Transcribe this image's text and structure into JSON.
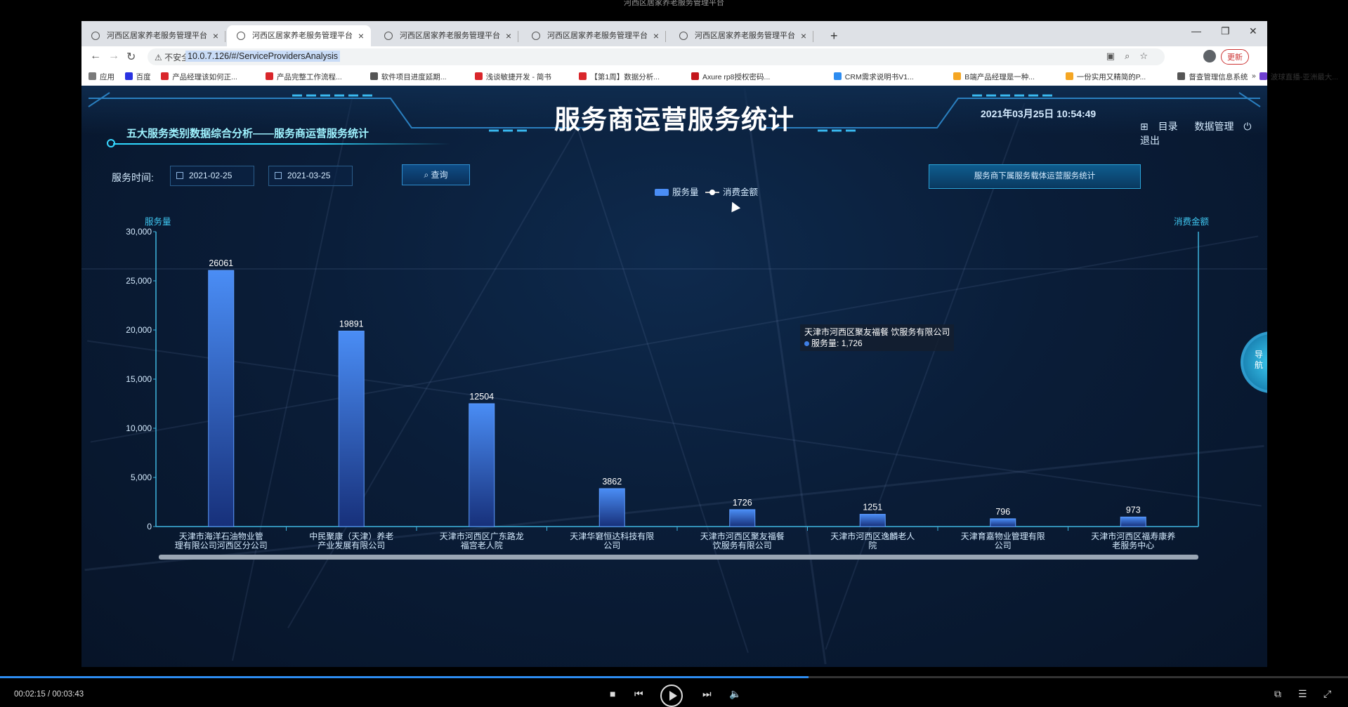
{
  "player": {
    "window_title": "河西区居家养老服务管理平台",
    "time_code": "00:02:15 / 00:03:43",
    "progress": 0.6
  },
  "browser": {
    "tabs": [
      {
        "label": "河西区居家养老服务管理平台",
        "active": false
      },
      {
        "label": "河西区居家养老服务管理平台",
        "active": true
      },
      {
        "label": "河西区居家养老服务管理平台",
        "active": false
      },
      {
        "label": "河西区居家养老服务管理平台",
        "active": false
      },
      {
        "label": "河西区居家养老服务管理平台",
        "active": false
      }
    ],
    "insecure_label": "不安全",
    "url": "10.0.7.126/#/ServiceProvidersAnalysis",
    "update_label": "更新",
    "bookmarks": [
      {
        "label": "应用",
        "color": "#7a7a7a"
      },
      {
        "label": "百度",
        "color": "#2932e1"
      },
      {
        "label": "产品经理该如何正...",
        "color": "#d9262b"
      },
      {
        "label": "产品完整工作流程...",
        "color": "#d9262b"
      },
      {
        "label": "软件项目进度延期...",
        "color": "#555555"
      },
      {
        "label": "浅谈敏捷开发 - 简书",
        "color": "#d9262b"
      },
      {
        "label": "【第1周】数据分析...",
        "color": "#d9262b"
      },
      {
        "label": "Axure rp8授权密码...",
        "color": "#c4161c"
      },
      {
        "label": "CRM需求说明书V1...",
        "color": "#2d8cf0"
      },
      {
        "label": "B端产品经理是一种...",
        "color": "#f5a623"
      },
      {
        "label": "一份实用又精简的P...",
        "color": "#f5a623"
      },
      {
        "label": "督查管理信息系统",
        "color": "#555555"
      },
      {
        "label": "波球直播-亚洲最大...",
        "color": "#6f3fd1"
      }
    ]
  },
  "dashboard": {
    "title": "服务商运营服务统计",
    "datetime": "2021年03月25日 10:54:49",
    "menu": {
      "catalog": "目录",
      "data_mgmt": "数据管理",
      "logout": "退出"
    },
    "subtitle": "五大服务类别数据综合分析——服务商运营服务统计",
    "time_label": "服务时间:",
    "date_start": "2021-02-25",
    "date_end": "2021-03-25",
    "query_label": "查询",
    "carrier_button": "服务商下属服务载体运营服务统计",
    "nav_float": "导航",
    "tooltip": {
      "title": "天津市河西区聚友福餐 饮服务有限公司",
      "series": "服务量",
      "value": "1,726"
    }
  },
  "chart_data": {
    "type": "bar",
    "legend": [
      "服务量",
      "消费金额"
    ],
    "left_axis_label": "服务量",
    "right_axis_label": "消费金额",
    "ylim": [
      0,
      30000
    ],
    "yticks": [
      "30,000",
      "25,000",
      "20,000",
      "15,000",
      "10,000",
      "5,000",
      "0"
    ],
    "categories": [
      "天津市海洋石油物业管理有限公司河西区分公司",
      "中民聚康（天津）养老产业发展有限公司",
      "天津市河西区广东路龙福宫老人院",
      "天津华窘恒达科技有限公司",
      "天津市河西区聚友福餐饮服务有限公司",
      "天津市河西区逸麟老人院",
      "天津育嘉物业管理有限公司",
      "天津市河西区福寿康养老服务中心"
    ],
    "category_lines": [
      [
        "天津市海洋石油物业管",
        "理有限公司河西区分公司"
      ],
      [
        "中民聚康（天津）养老",
        "产业发展有限公司"
      ],
      [
        "天津市河西区广东路龙",
        "福宫老人院"
      ],
      [
        "天津华窘恒达科技有限",
        "公司"
      ],
      [
        "天津市河西区聚友福餐",
        "饮服务有限公司"
      ],
      [
        "天津市河西区逸麟老人",
        "院"
      ],
      [
        "天津育嘉物业管理有限",
        "公司"
      ],
      [
        "天津市河西区福寿康养",
        "老服务中心"
      ]
    ],
    "series": [
      {
        "name": "服务量",
        "values": [
          26061,
          19891,
          12504,
          3862,
          1726,
          1251,
          796,
          973
        ]
      }
    ],
    "colors": {
      "bar_top": "#4a8df5",
      "bar_bottom": "#17307a",
      "axis": "#3fb6e0",
      "label": "#ffffff"
    }
  }
}
